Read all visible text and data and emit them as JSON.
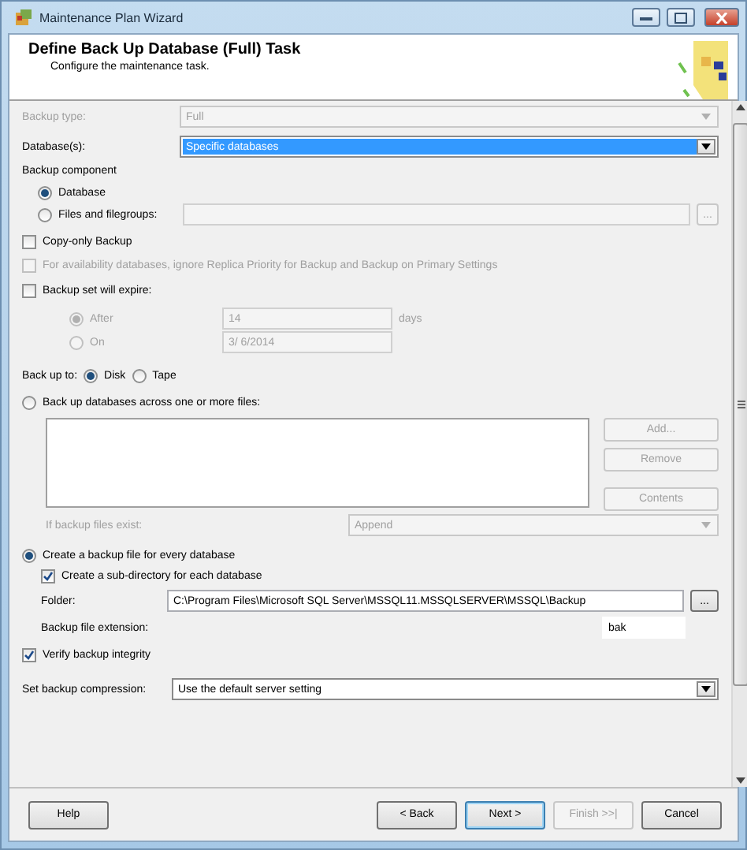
{
  "window": {
    "title": "Maintenance Plan Wizard"
  },
  "header": {
    "title": "Define Back Up Database (Full) Task",
    "subtitle": "Configure the maintenance task."
  },
  "backup_type": {
    "label": "Backup type:",
    "value": "Full",
    "disabled": true
  },
  "databases": {
    "label": "Database(s):",
    "value": "Specific databases",
    "disabled": false
  },
  "backup_component": {
    "label": "Backup component",
    "options": [
      {
        "label": "Database",
        "selected": true
      },
      {
        "label": "Files and filegroups:",
        "selected": false
      }
    ]
  },
  "copy_only": {
    "label": "Copy-only Backup",
    "checked": false,
    "disabled": false
  },
  "availability": {
    "label": "For availability databases, ignore Replica Priority for Backup and Backup on Primary Settings",
    "checked": false,
    "disabled": true
  },
  "expire": {
    "label": "Backup set will expire:",
    "checked": false,
    "after": {
      "label": "After",
      "selected": true,
      "value": "14",
      "unit": "days"
    },
    "on": {
      "label": "On",
      "selected": false,
      "value": "3/ 6/2014"
    }
  },
  "back_up_to": {
    "label": "Back up to:",
    "options": [
      {
        "label": "Disk",
        "selected": true
      },
      {
        "label": "Tape",
        "selected": false
      }
    ]
  },
  "across_files": {
    "label": "Back up databases across one or more files:",
    "selected": false,
    "buttons": [
      "Add...",
      "Remove",
      "Contents"
    ],
    "if_exists": {
      "label": "If backup files exist:",
      "value": "Append"
    }
  },
  "per_database": {
    "label": "Create a backup file for every database",
    "selected": true,
    "subdirectory": {
      "label": "Create a sub-directory for each database",
      "checked": true
    },
    "folder": {
      "label": "Folder:",
      "value": "C:\\Program Files\\Microsoft SQL Server\\MSSQL11.MSSQLSERVER\\MSSQL\\Backup",
      "browse": "..."
    },
    "extension": {
      "label": "Backup file extension:",
      "value": "bak"
    }
  },
  "verify": {
    "label": "Verify backup integrity",
    "checked": true
  },
  "compression": {
    "label": "Set backup compression:",
    "value": "Use the default server setting"
  },
  "buttons": [
    {
      "label": "Help",
      "disabled": false,
      "default": false
    },
    {
      "label": "< Back",
      "disabled": false,
      "default": false
    },
    {
      "label": "Next >",
      "disabled": false,
      "default": true
    },
    {
      "label": "Finish >>|",
      "disabled": true,
      "default": false
    },
    {
      "label": "Cancel",
      "disabled": false,
      "default": false
    }
  ]
}
